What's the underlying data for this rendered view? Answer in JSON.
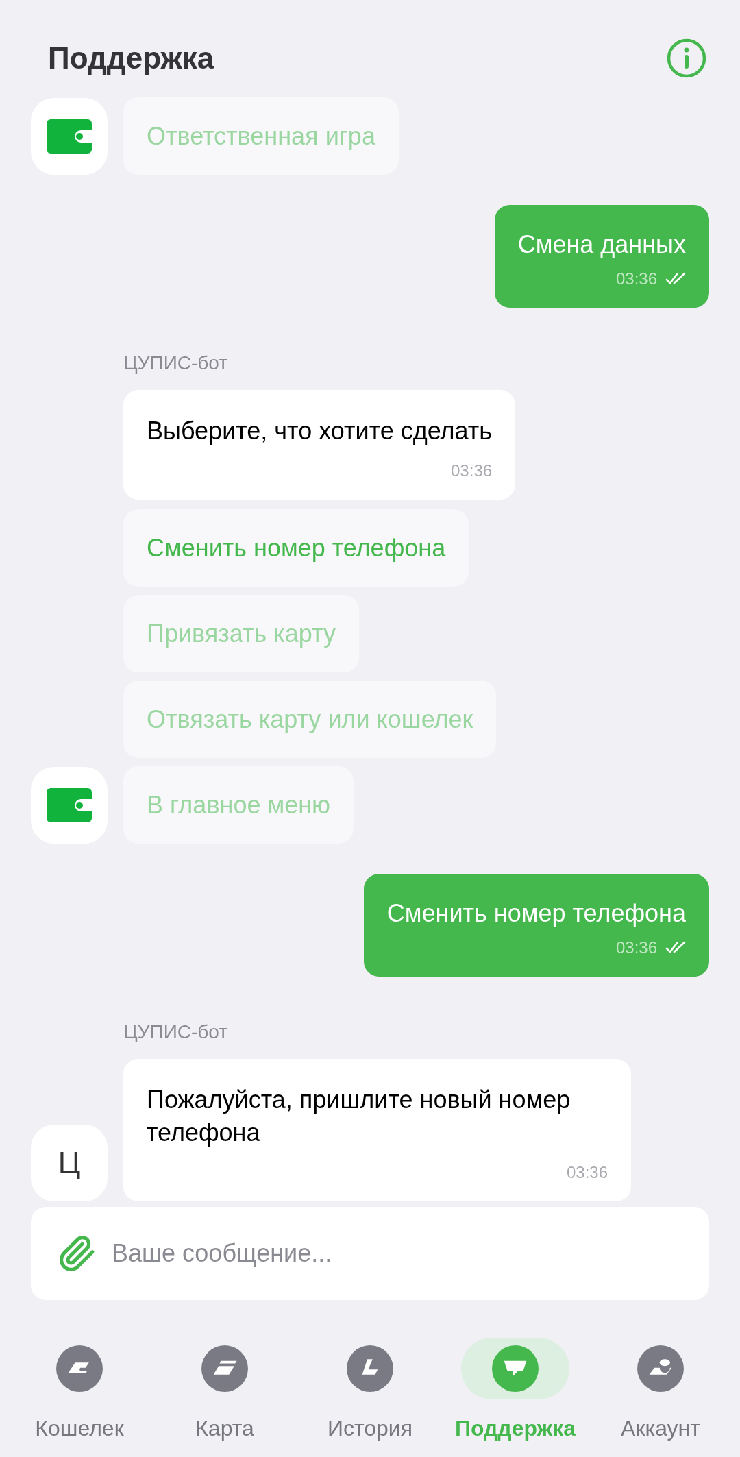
{
  "header": {
    "title": "Поддержка"
  },
  "messages": [
    {
      "kind": "options",
      "avatar": {
        "kind": "wallet"
      },
      "options": [
        {
          "label": "Ответственная игра",
          "disabled": true
        }
      ]
    },
    {
      "kind": "outgoing",
      "text": "Смена данных",
      "time": "03:36",
      "read": true
    },
    {
      "kind": "incoming",
      "sender": "ЦУПИС-бот",
      "text": "Выберите, что хотите сделать",
      "time": "03:36"
    },
    {
      "kind": "options",
      "avatar": {
        "kind": "wallet"
      },
      "options": [
        {
          "label": "Сменить номер телефона",
          "disabled": false
        },
        {
          "label": "Привязать карту",
          "disabled": true
        },
        {
          "label": "Отвязать карту или кошелек",
          "disabled": true
        },
        {
          "label": "В главное меню",
          "disabled": true
        }
      ]
    },
    {
      "kind": "outgoing",
      "text": "Сменить номер телефона",
      "time": "03:36",
      "read": true
    },
    {
      "kind": "incoming",
      "sender": "ЦУПИС-бот",
      "text": "Пожалуйста, пришлите новый номер телефона",
      "time": "03:36",
      "avatar_letter": "Ц"
    }
  ],
  "composer": {
    "placeholder": "Ваше сообщение..."
  },
  "nav": [
    {
      "label": "Кошелек",
      "selected": false
    },
    {
      "label": "Карта",
      "selected": false
    },
    {
      "label": "История",
      "selected": false
    },
    {
      "label": "Поддержка",
      "selected": true
    },
    {
      "label": "Аккаунт",
      "selected": false
    }
  ]
}
